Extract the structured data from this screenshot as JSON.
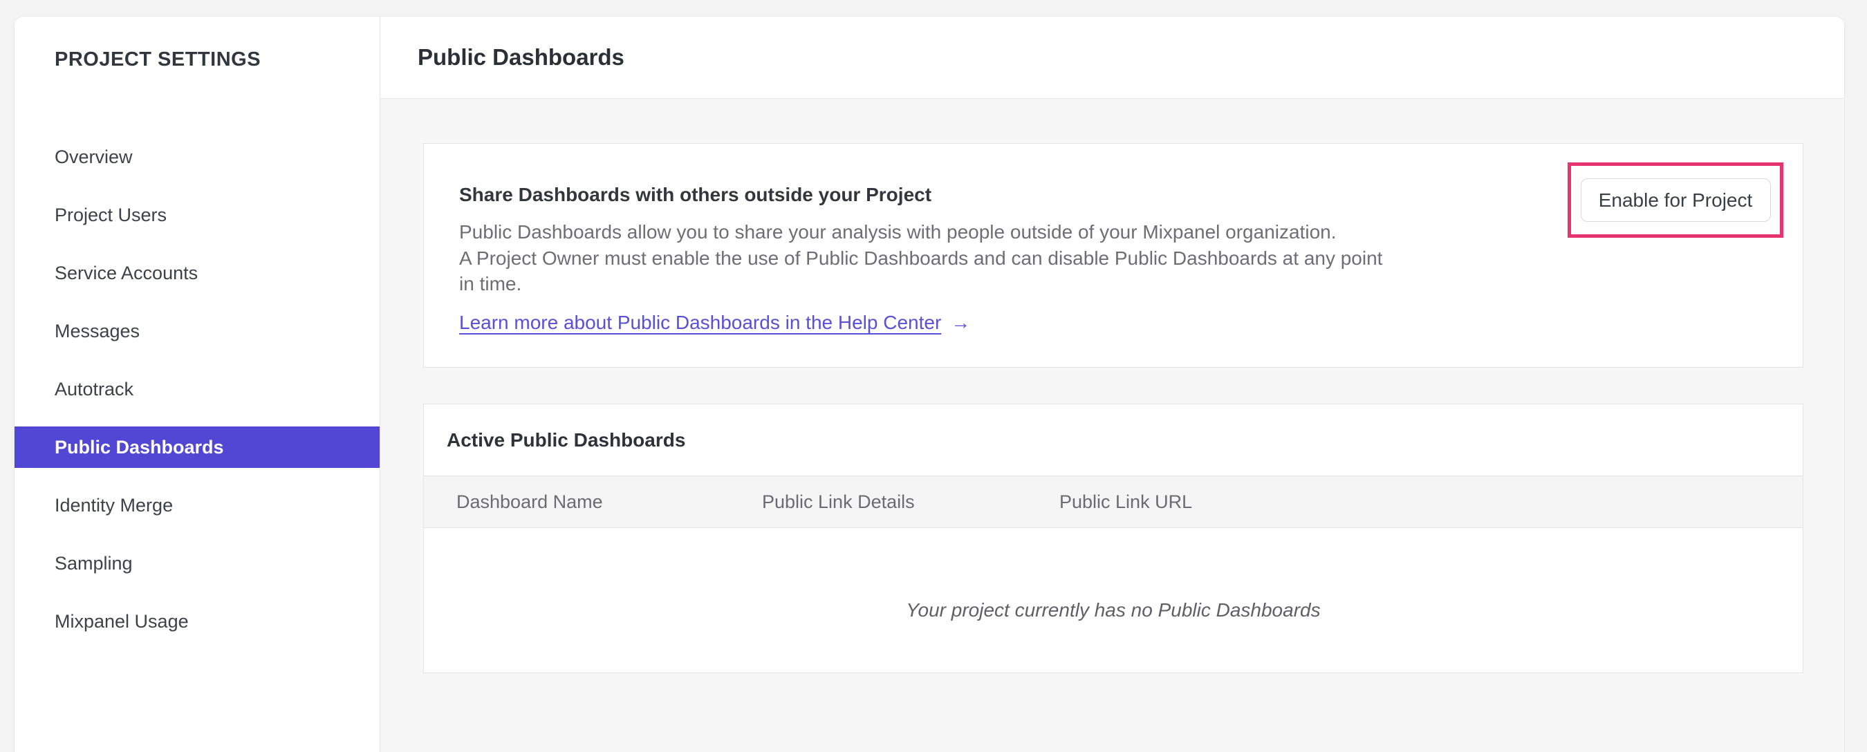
{
  "sidebar": {
    "title": "PROJECT SETTINGS",
    "items": [
      {
        "label": "Overview"
      },
      {
        "label": "Project Users"
      },
      {
        "label": "Service Accounts"
      },
      {
        "label": "Messages"
      },
      {
        "label": "Autotrack"
      },
      {
        "label": "Public Dashboards",
        "selected": true
      },
      {
        "label": "Identity Merge"
      },
      {
        "label": "Sampling"
      },
      {
        "label": "Mixpanel Usage"
      }
    ]
  },
  "header": {
    "title": "Public Dashboards"
  },
  "share_card": {
    "heading": "Share Dashboards with others outside your Project",
    "body_line1": "Public Dashboards allow you to share your analysis with people outside of your Mixpanel organization.",
    "body_line2": "A Project Owner must enable the use of Public Dashboards and can disable Public Dashboards at any point",
    "body_line3": "in time.",
    "link_label": "Learn more about Public Dashboards in the Help Center",
    "link_arrow": "→",
    "button_label": "Enable for Project"
  },
  "active_card": {
    "heading": "Active Public Dashboards",
    "columns": [
      "Dashboard Name",
      "Public Link Details",
      "Public Link URL"
    ],
    "rows": [],
    "empty_message": "Your project currently has no Public Dashboards"
  },
  "colors": {
    "accent_purple": "#5247d5",
    "link_purple": "#5a50d8",
    "annotation_pink": "#e5346f",
    "content_background": "#f7f7f8"
  }
}
